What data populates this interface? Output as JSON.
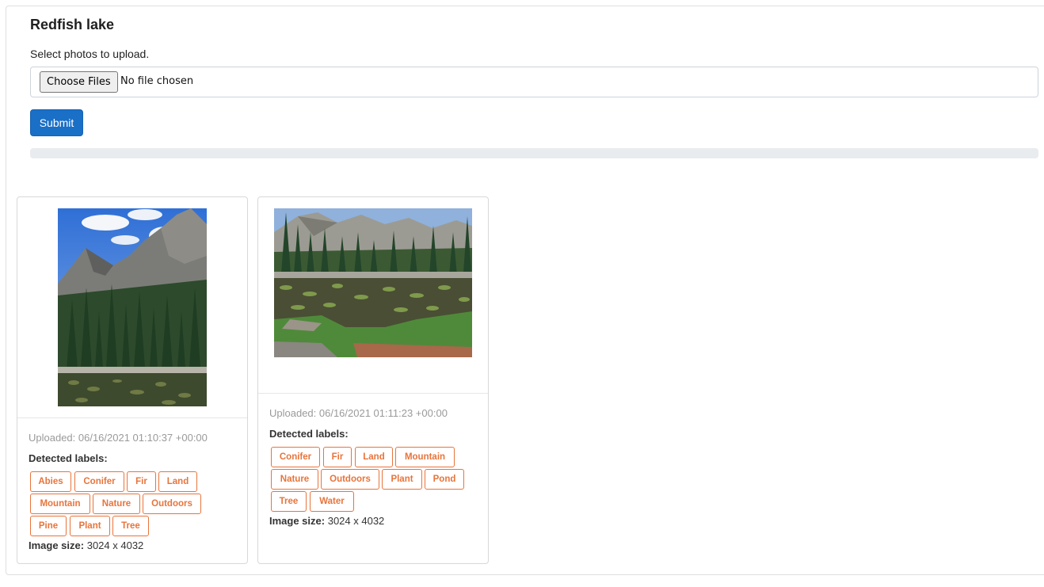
{
  "album": {
    "title": "Redfish lake",
    "instruction": "Select photos to upload."
  },
  "upload": {
    "choose_label": "Choose Files",
    "file_status": "No file chosen",
    "submit_label": "Submit",
    "progress_fraction": 0
  },
  "photos": [
    {
      "uploaded": "Uploaded: 06/16/2021 01:10:37 +00:00",
      "detected_heading": "Detected labels:",
      "labels": [
        "Abies",
        "Conifer",
        "Fir",
        "Land",
        "Mountain",
        "Nature",
        "Outdoors",
        "Pine",
        "Plant",
        "Tree"
      ],
      "size_label": "Image size:",
      "size_value": "3024 x 4032"
    },
    {
      "uploaded": "Uploaded: 06/16/2021 01:11:23 +00:00",
      "detected_heading": "Detected labels:",
      "labels": [
        "Conifer",
        "Fir",
        "Land",
        "Mountain",
        "Nature",
        "Outdoors",
        "Plant",
        "Pond",
        "Tree",
        "Water"
      ],
      "size_label": "Image size:",
      "size_value": "3024 x 4032"
    }
  ],
  "colors": {
    "primary": "#1a6fc6",
    "tag": "#e8743b"
  }
}
